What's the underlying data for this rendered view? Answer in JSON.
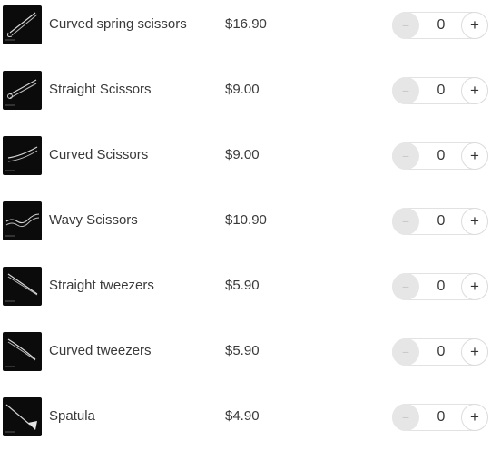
{
  "products": [
    {
      "name": "Curved spring scissors",
      "price": "$16.90",
      "quantity": "0",
      "minus_label": "−",
      "plus_label": "+",
      "image_icon": "spring-scissors-icon"
    },
    {
      "name": "Straight Scissors",
      "price": "$9.00",
      "quantity": "0",
      "minus_label": "−",
      "plus_label": "+",
      "image_icon": "straight-scissors-icon"
    },
    {
      "name": "Curved Scissors",
      "price": "$9.00",
      "quantity": "0",
      "minus_label": "−",
      "plus_label": "+",
      "image_icon": "curved-scissors-icon"
    },
    {
      "name": "Wavy Scissors",
      "price": "$10.90",
      "quantity": "0",
      "minus_label": "−",
      "plus_label": "+",
      "image_icon": "wavy-scissors-icon"
    },
    {
      "name": "Straight tweezers",
      "price": "$5.90",
      "quantity": "0",
      "minus_label": "−",
      "plus_label": "+",
      "image_icon": "straight-tweezers-icon"
    },
    {
      "name": "Curved tweezers",
      "price": "$5.90",
      "quantity": "0",
      "minus_label": "−",
      "plus_label": "+",
      "image_icon": "curved-tweezers-icon"
    },
    {
      "name": "Spatula",
      "price": "$4.90",
      "quantity": "0",
      "minus_label": "−",
      "plus_label": "+",
      "image_icon": "spatula-icon"
    }
  ],
  "colors": {
    "thumbnail_background": "#0b0b0b",
    "minus_button_background": "#e6e6e6",
    "text": "#3a3a3a"
  }
}
